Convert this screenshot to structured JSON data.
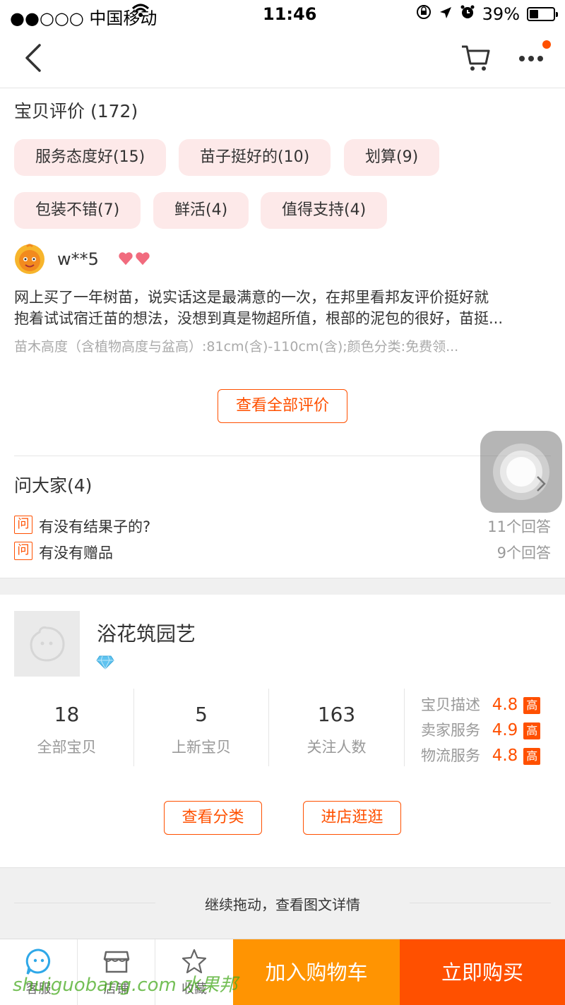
{
  "status_bar": {
    "carrier": "●●○○○ 中国移动",
    "time": "11:46",
    "battery": "39%",
    "battery_level": 0.39
  },
  "reviews": {
    "title": "宝贝评价",
    "count": "(172)",
    "tags": [
      "服务态度好(15)",
      "苗子挺好的(10)",
      "划算(9)",
      "包装不错(7)",
      "鲜活(4)",
      "值得支持(4)"
    ],
    "reviewer": {
      "name": "w**5",
      "text_line1": "网上买了一年树苗，说实话这是最满意的一次，在邦里看邦友评价挺好就",
      "text_line2": "抱着试试宿迁苗的想法，没想到真是物超所值，根部的泥包的很好，苗挺...",
      "spec": "苗木高度（含植物高度与盆高）:81cm(含)-110cm(含);颜色分类:免费领..."
    },
    "view_all": "查看全部评价"
  },
  "ask": {
    "title": "问大家(4)",
    "items": [
      {
        "badge": "问",
        "question": "有没有结果子的?",
        "answers": "11个回答"
      },
      {
        "badge": "问",
        "question": "有没有赠品",
        "answers": "9个回答"
      }
    ]
  },
  "shop": {
    "name": "浴花筑园艺",
    "stats": [
      {
        "value": "18",
        "label": "全部宝贝"
      },
      {
        "value": "5",
        "label": "上新宝贝"
      },
      {
        "value": "163",
        "label": "关注人数"
      }
    ],
    "ratings": [
      {
        "label": "宝贝描述",
        "score": "4.8",
        "level": "高"
      },
      {
        "label": "卖家服务",
        "score": "4.9",
        "level": "高"
      },
      {
        "label": "物流服务",
        "score": "4.8",
        "level": "高"
      }
    ],
    "btn_category": "查看分类",
    "btn_enter": "进店逛逛"
  },
  "continue_drag": "继续拖动，查看图文详情",
  "bottom_bar": {
    "service": "客服",
    "store": "店铺",
    "favorite": "收藏",
    "add_cart": "加入购物车",
    "buy_now": "立即购买"
  },
  "watermark": "shuiguobang.com 水果邦",
  "colors": {
    "accent": "#ff5000",
    "cart_orange": "#ff9402",
    "tag_bg": "#fde9e9"
  }
}
